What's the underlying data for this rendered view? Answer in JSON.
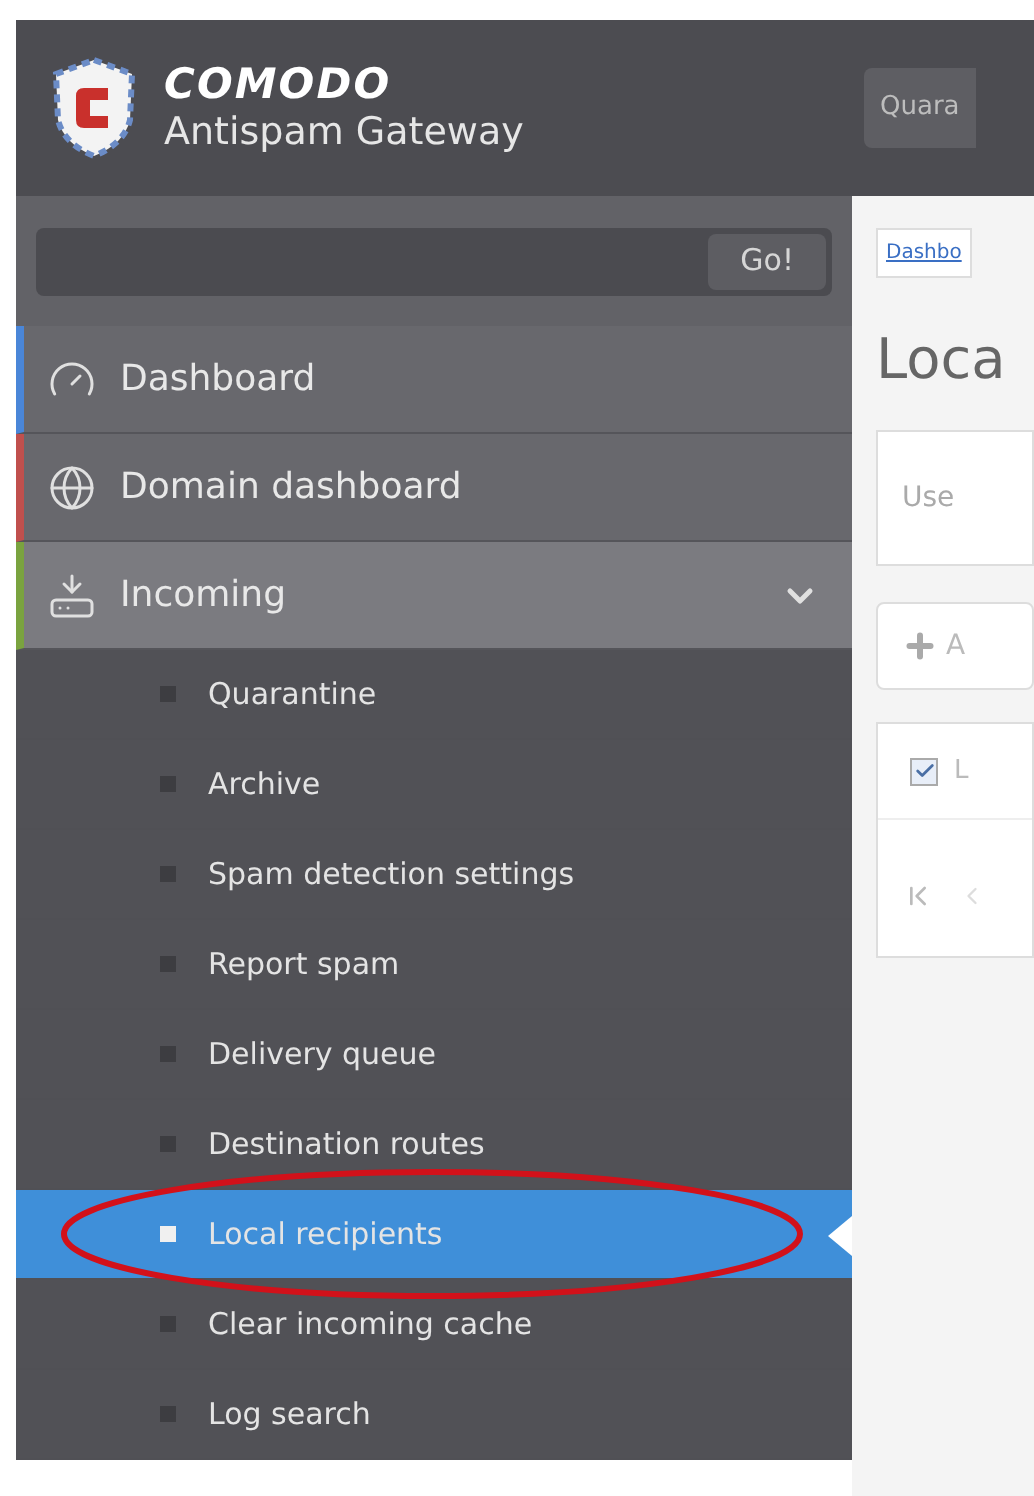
{
  "header": {
    "brand": "COMODO",
    "product": "Antispam Gateway",
    "top_button": "Quara"
  },
  "search": {
    "button": "Go!"
  },
  "menu": [
    {
      "label": "Dashboard",
      "color": "#4a86d8",
      "expanded": false
    },
    {
      "label": "Domain dashboard",
      "color": "#c0504d",
      "expanded": false
    },
    {
      "label": "Incoming",
      "color": "#7aa33f",
      "expanded": true,
      "children": [
        {
          "label": "Quarantine",
          "selected": false
        },
        {
          "label": "Archive",
          "selected": false
        },
        {
          "label": "Spam detection settings",
          "selected": false
        },
        {
          "label": "Report spam",
          "selected": false
        },
        {
          "label": "Delivery queue",
          "selected": false
        },
        {
          "label": "Destination routes",
          "selected": false
        },
        {
          "label": "Local recipients",
          "selected": true
        },
        {
          "label": "Clear incoming cache",
          "selected": false
        },
        {
          "label": "Log search",
          "selected": false
        }
      ]
    }
  ],
  "content": {
    "breadcrumb": "Dashbo",
    "title": "Loca",
    "info": "Use",
    "add_button": "A",
    "checkbox": {
      "label": "L",
      "checked": true
    }
  },
  "annotation": {
    "kind": "ellipse"
  }
}
